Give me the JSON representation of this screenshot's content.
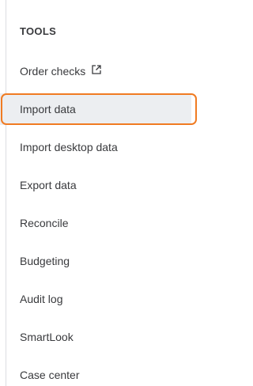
{
  "tools_menu": {
    "heading": "TOOLS",
    "items": [
      {
        "label": "Order checks",
        "icon": "external-link-icon"
      },
      {
        "label": "Import data",
        "selected": true
      },
      {
        "label": "Import desktop data"
      },
      {
        "label": "Export data"
      },
      {
        "label": "Reconcile"
      },
      {
        "label": "Budgeting"
      },
      {
        "label": "Audit log"
      },
      {
        "label": "SmartLook"
      },
      {
        "label": "Case center"
      }
    ],
    "colors": {
      "highlight_border": "#f07b22",
      "selected_background": "#eceef1",
      "text": "#393a3d"
    }
  }
}
